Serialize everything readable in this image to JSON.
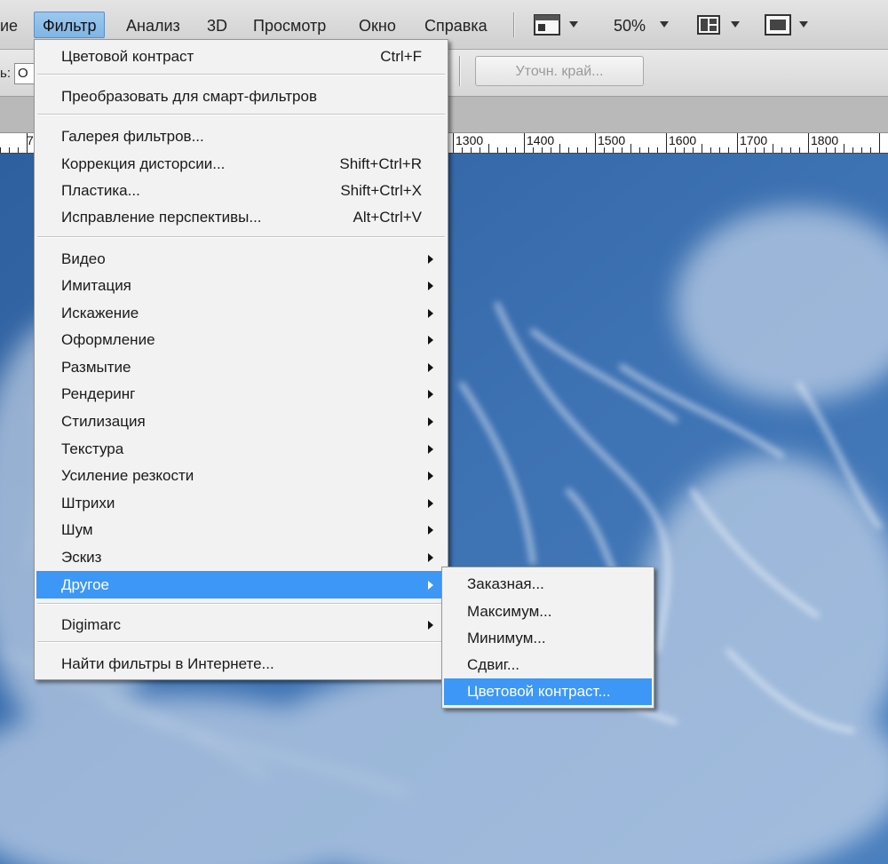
{
  "menubar": {
    "items": [
      {
        "label": "ие"
      },
      {
        "label": "Фильтр"
      },
      {
        "label": "Анализ"
      },
      {
        "label": "3D"
      },
      {
        "label": "Просмотр"
      },
      {
        "label": "Окно"
      },
      {
        "label": "Справка"
      }
    ],
    "zoom": "50%"
  },
  "options": {
    "field_prefix": "ь:",
    "field_value": "О",
    "refine_edge": "Уточн. край..."
  },
  "ruler": {
    "labels": [
      "7",
      "1300",
      "1400",
      "1500",
      "1600",
      "1700",
      "1800"
    ]
  },
  "filter_menu": {
    "items": [
      {
        "label": "Цветовой контраст",
        "shortcut": "Ctrl+F"
      },
      {
        "label": "Преобразовать для смарт-фильтров"
      },
      {
        "label": "Галерея фильтров..."
      },
      {
        "label": "Коррекция дисторсии...",
        "shortcut": "Shift+Ctrl+R"
      },
      {
        "label": "Пластика...",
        "shortcut": "Shift+Ctrl+X"
      },
      {
        "label": "Исправление перспективы...",
        "shortcut": "Alt+Ctrl+V"
      },
      {
        "label": "Видео"
      },
      {
        "label": "Имитация"
      },
      {
        "label": "Искажение"
      },
      {
        "label": "Оформление"
      },
      {
        "label": "Размытие"
      },
      {
        "label": "Рендеринг"
      },
      {
        "label": "Стилизация"
      },
      {
        "label": "Текстура"
      },
      {
        "label": "Усиление резкости"
      },
      {
        "label": "Штрихи"
      },
      {
        "label": "Шум"
      },
      {
        "label": "Эскиз"
      },
      {
        "label": "Другое"
      },
      {
        "label": "Digimarc"
      },
      {
        "label": "Найти фильтры в Интернете..."
      }
    ]
  },
  "other_submenu": {
    "items": [
      {
        "label": "Заказная..."
      },
      {
        "label": "Максимум..."
      },
      {
        "label": "Минимум..."
      },
      {
        "label": "Сдвиг..."
      },
      {
        "label": "Цветовой контраст..."
      }
    ]
  },
  "colors": {
    "highlight": "#3c97f7",
    "sky": "#3b6fae"
  }
}
